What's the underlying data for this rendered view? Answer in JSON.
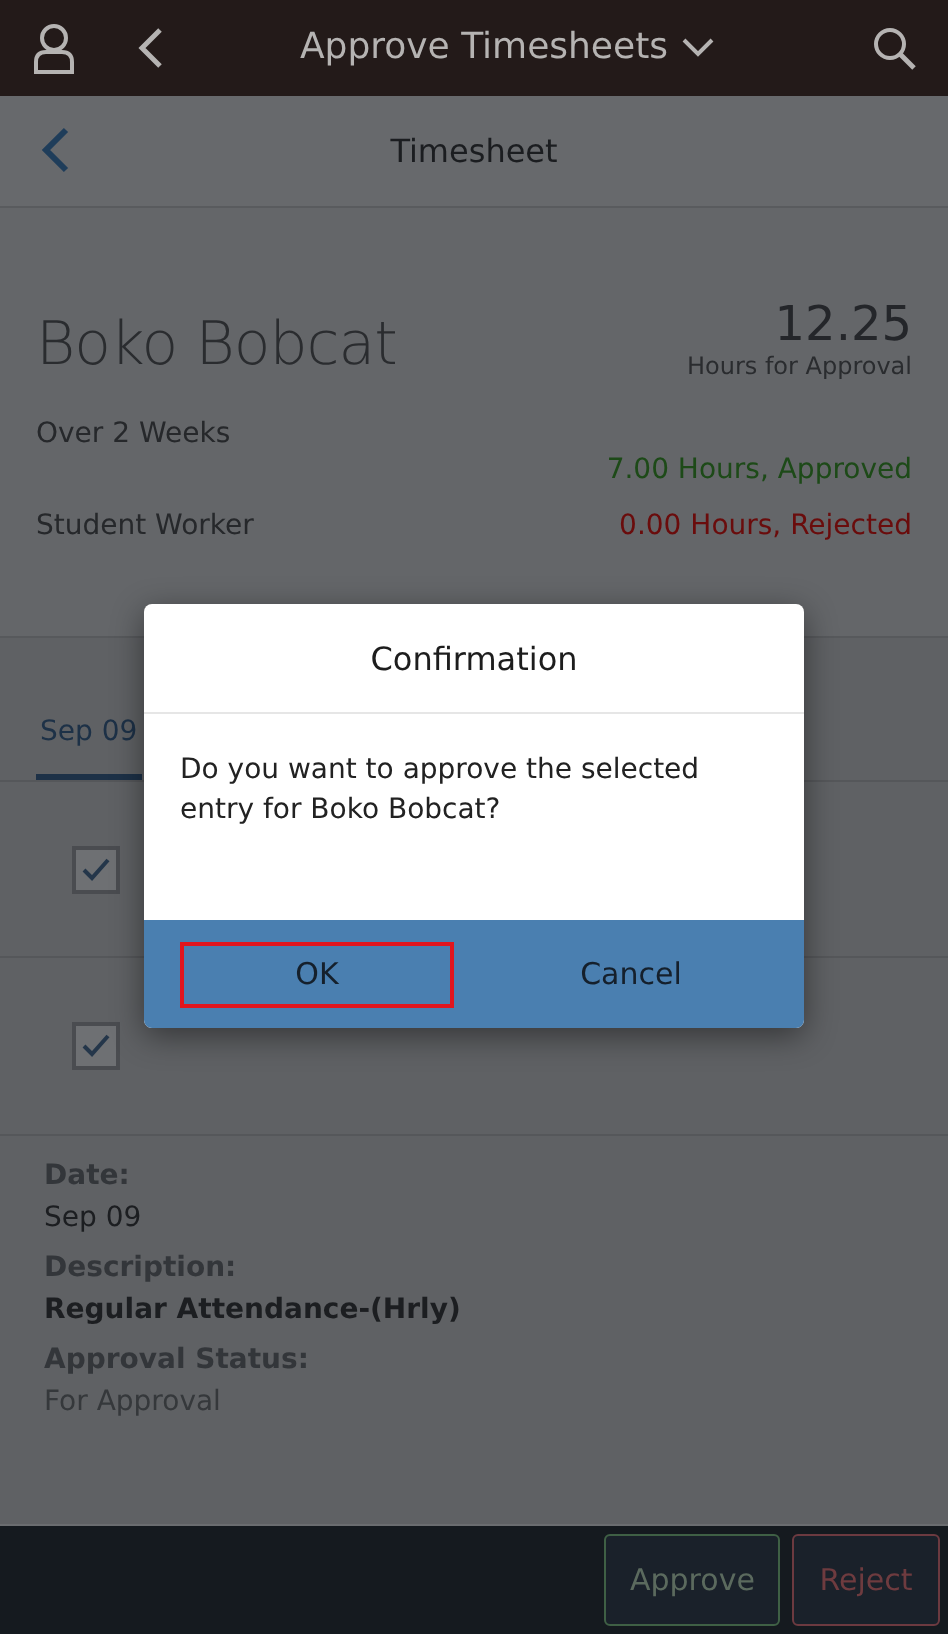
{
  "header": {
    "title": "Approve Timesheets"
  },
  "page": {
    "title": "Timesheet"
  },
  "employee": {
    "name": "Boko Bobcat",
    "hours": "12.25",
    "hours_label": "Hours for Approval",
    "period": "Over 2 Weeks",
    "job": "Student Worker",
    "approved": "7.00 Hours, Approved",
    "rejected": "0.00 Hours, Rejected"
  },
  "tabs": [
    {
      "label": "Sep 09",
      "selected": true
    }
  ],
  "entries": [
    {
      "checked": true
    },
    {
      "checked": true
    }
  ],
  "details": [
    {
      "label": "Date:",
      "value": "Sep 09",
      "kind": "plain"
    },
    {
      "label": "Description:",
      "value": "Regular Attendance-(Hrly)",
      "kind": "strong"
    },
    {
      "label": "Approval Status:",
      "value": "For Approval",
      "kind": "muted"
    }
  ],
  "footer_buttons": [
    {
      "label": "Approve",
      "kind": "approve"
    },
    {
      "label": "Reject",
      "kind": "reject"
    }
  ],
  "dialog": {
    "title": "Confirmation",
    "message": "Do you want to approve the selected entry for Boko Bobcat?",
    "buttons": [
      {
        "label": "OK",
        "selected": true
      },
      {
        "label": "Cancel",
        "selected": false
      }
    ]
  }
}
